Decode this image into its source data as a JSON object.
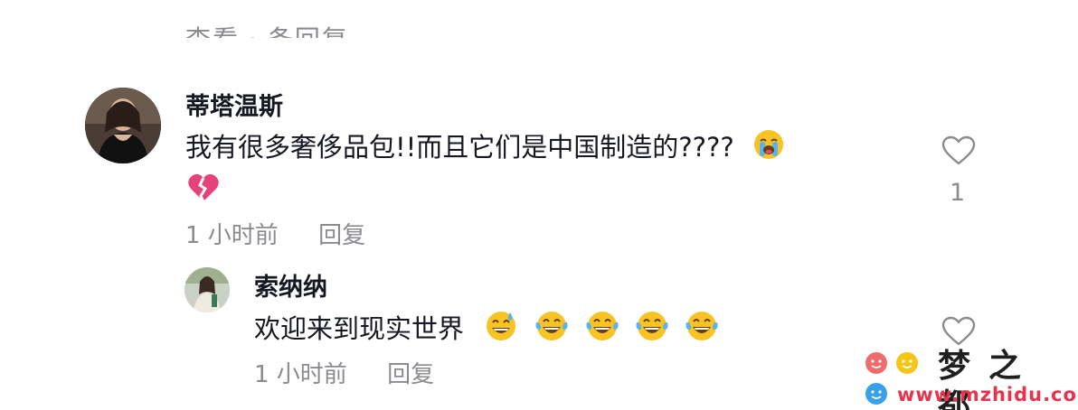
{
  "top_row": {
    "left": "查看",
    "separator": "·",
    "right": "条回复"
  },
  "comments": [
    {
      "username": "蒂塔温斯",
      "text": "我有很多奢侈品包!!而且它们是中国制造的????",
      "emoji": [
        "loudly-crying-face",
        "broken-heart"
      ],
      "time": "1 小时前",
      "reply_label": "回复",
      "like_count": "1"
    },
    {
      "username": "索纳纳",
      "text": "欢迎来到现实世界",
      "emoji": [
        "grinning-face-with-sweat",
        "face-with-tears-of-joy",
        "face-with-tears-of-joy",
        "face-with-tears-of-joy",
        "face-with-tears-of-joy"
      ],
      "time": "1 小时前",
      "reply_label": "回复"
    }
  ],
  "watermark": {
    "name": "梦之都",
    "url": "www.mzhidu.com"
  },
  "colors": {
    "text_primary": "#161823",
    "text_secondary": "#8a8b91",
    "watermark_red": "#e8334a",
    "watermark_blue": "#3aa0e8",
    "watermark_yellow": "#f5c518"
  }
}
